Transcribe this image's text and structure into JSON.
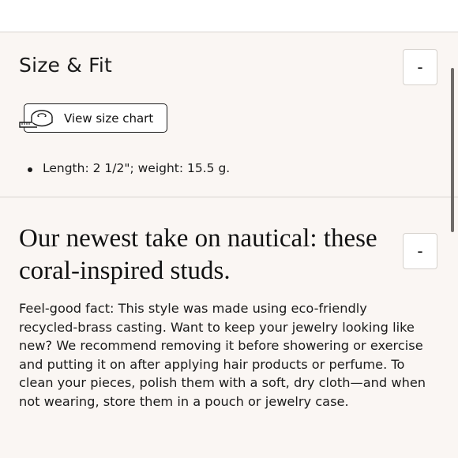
{
  "size_fit": {
    "title": "Size & Fit",
    "collapse_label": "-",
    "size_chart_button": {
      "label": "View size chart",
      "icon": "measuring-tape-icon"
    },
    "specs": [
      "Length: 2 1/2\"; weight: 15.5 g."
    ]
  },
  "description": {
    "heading": "Our newest take on nautical: these coral-inspired studs.",
    "collapse_label": "-",
    "body": "Feel-good fact: This style was made using eco-friendly recycled-brass casting. Want to keep your jewelry looking like new? We recommend removing it before showering or exercise and putting it on after applying hair products or perfume. To clean your pieces, polish them with a soft, dry cloth—and when not wearing, store them in a pouch or jewelry case."
  },
  "colors": {
    "background": "#faf6f3",
    "divider": "#d8d3cf",
    "text": "#1a1a1a"
  }
}
